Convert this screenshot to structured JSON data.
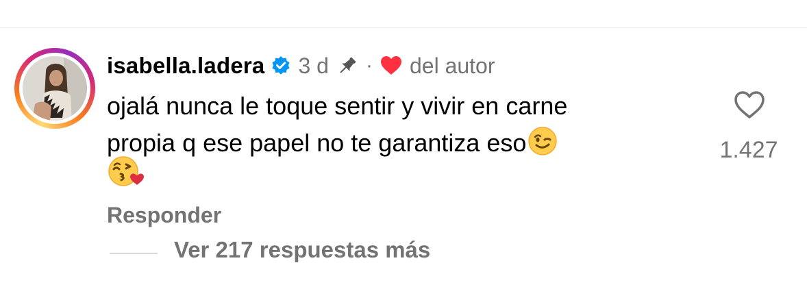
{
  "comment": {
    "username": "isabella.ladera",
    "verified": true,
    "time": "3 d",
    "separator": "·",
    "author_badge": "del autor",
    "text_line1": "ojalá nunca le toque sentir y vivir en carne",
    "text_line2": "propia q ese papel no te garantiza eso",
    "emojis": [
      "winking-face",
      "face-blowing-a-kiss"
    ],
    "like_count": "1.427",
    "reply_label": "Responder",
    "view_replies_label": "Ver 217 respuestas más"
  },
  "icons": {
    "verified": "verified-badge-icon",
    "pin": "pin-icon",
    "author_heart": "heart-filled-icon",
    "like": "heart-outline-icon"
  },
  "colors": {
    "verified_blue": "#0095f6",
    "author_heart_red": "#ff3040",
    "secondary_text": "#737373",
    "primary_text": "#000000"
  }
}
